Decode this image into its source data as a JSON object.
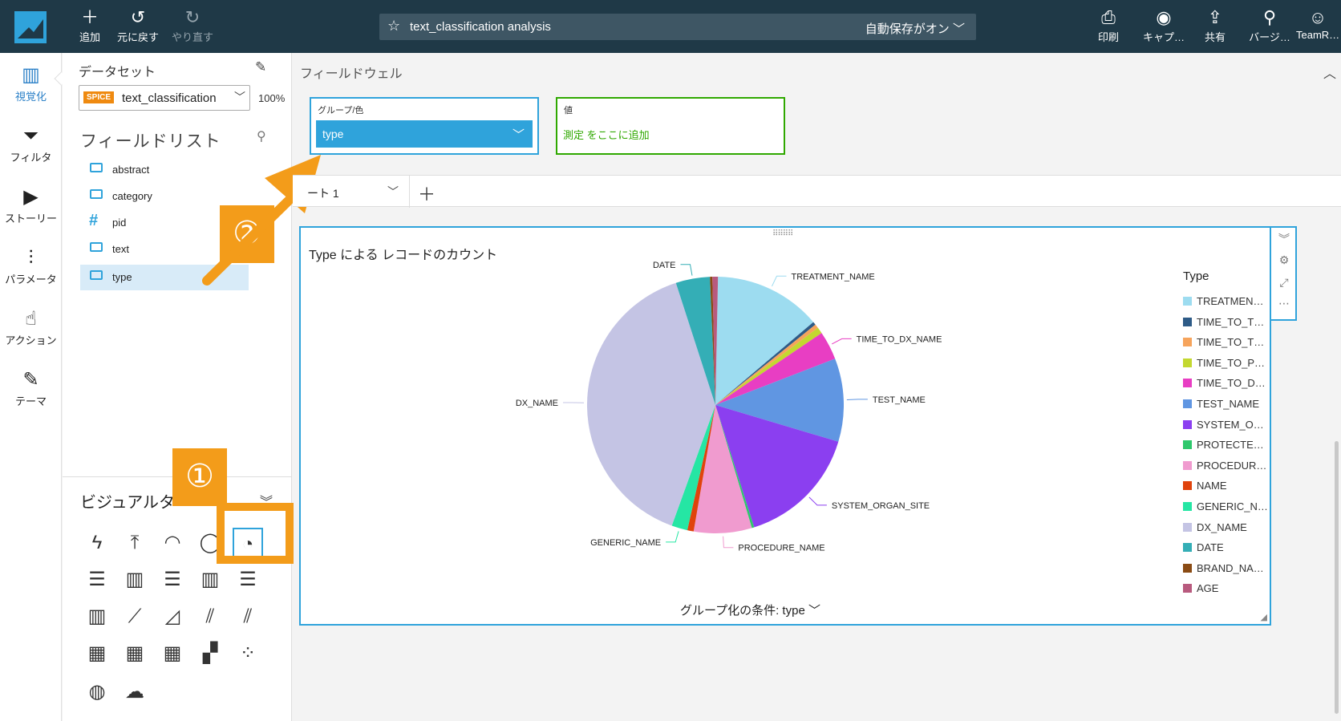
{
  "topbar": {
    "add": "追加",
    "undo": "元に戻す",
    "redo": "やり直す",
    "analysis_title": "text_classification analysis",
    "autosave": "自動保存がオン",
    "print": "印刷",
    "capture": "キャプ…",
    "share": "共有",
    "version": "バージ…",
    "user": "TeamR…"
  },
  "rail": {
    "visualize": "視覚化",
    "filter": "フィルタ",
    "story": "ストーリー",
    "parameter": "パラメータ",
    "action": "アクション",
    "theme": "テーマ"
  },
  "panel": {
    "dataset_label": "データセット",
    "spice": "SPICE",
    "dataset_name": "text_classification",
    "percent": "100%",
    "field_list_title": "フィールドリスト",
    "fields": [
      "abstract",
      "category",
      "pid",
      "text",
      "type"
    ],
    "visual_types_title": "ビジュアルタ"
  },
  "annotations": {
    "one": "①",
    "two": "②"
  },
  "fieldwell": {
    "title": "フィールドウェル",
    "group_label": "グループ/色",
    "group_value": "type",
    "value_label": "値",
    "value_add": "測定 をここに追加"
  },
  "sheet": {
    "tab": "ート 1"
  },
  "visual": {
    "title": "Type による レコードのカウント",
    "group_by": "グループ化の条件: type",
    "legend_title": "Type",
    "colors": {
      "accent": "#2fa3db",
      "value_well": "#2fa800",
      "annotation": "#f39c1a",
      "topbar": "#1f3947"
    }
  },
  "chart_data": {
    "type": "pie",
    "title": "Type による レコードのカウント",
    "legend_title": "Type",
    "legend": [
      "TREATMEN…",
      "TIME_TO_T…",
      "TIME_TO_T…",
      "TIME_TO_P…",
      "TIME_TO_D…",
      "TEST_NAME",
      "SYSTEM_O…",
      "PROTECTE…",
      "PROCEDUR…",
      "NAME",
      "GENERIC_N…",
      "DX_NAME",
      "DATE",
      "BRAND_NA…",
      "AGE"
    ],
    "slice_labels": [
      "TREATMENT_NAME",
      "",
      "",
      "",
      "TIME_TO_DX_NAME",
      "TEST_NAME",
      "SYSTEM_ORGAN_SITE",
      "",
      "PROCEDURE_NAME",
      "",
      "GENERIC_NAME",
      "DX_NAME",
      "DATE",
      "",
      ""
    ],
    "values": [
      13.5,
      0.4,
      0.5,
      0.8,
      3.6,
      10.5,
      15.5,
      0.3,
      7.3,
      0.8,
      2.0,
      39.5,
      4.3,
      0.3,
      0.7
    ],
    "colors": [
      "#9ddcf0",
      "#2e5b87",
      "#f6a45c",
      "#c3d830",
      "#e83ec3",
      "#6096e2",
      "#8b3ff0",
      "#2ec86c",
      "#f09bcf",
      "#e0430c",
      "#25e6a4",
      "#c4c4e4",
      "#34aeb6",
      "#8a4b14",
      "#b85a7e"
    ]
  }
}
